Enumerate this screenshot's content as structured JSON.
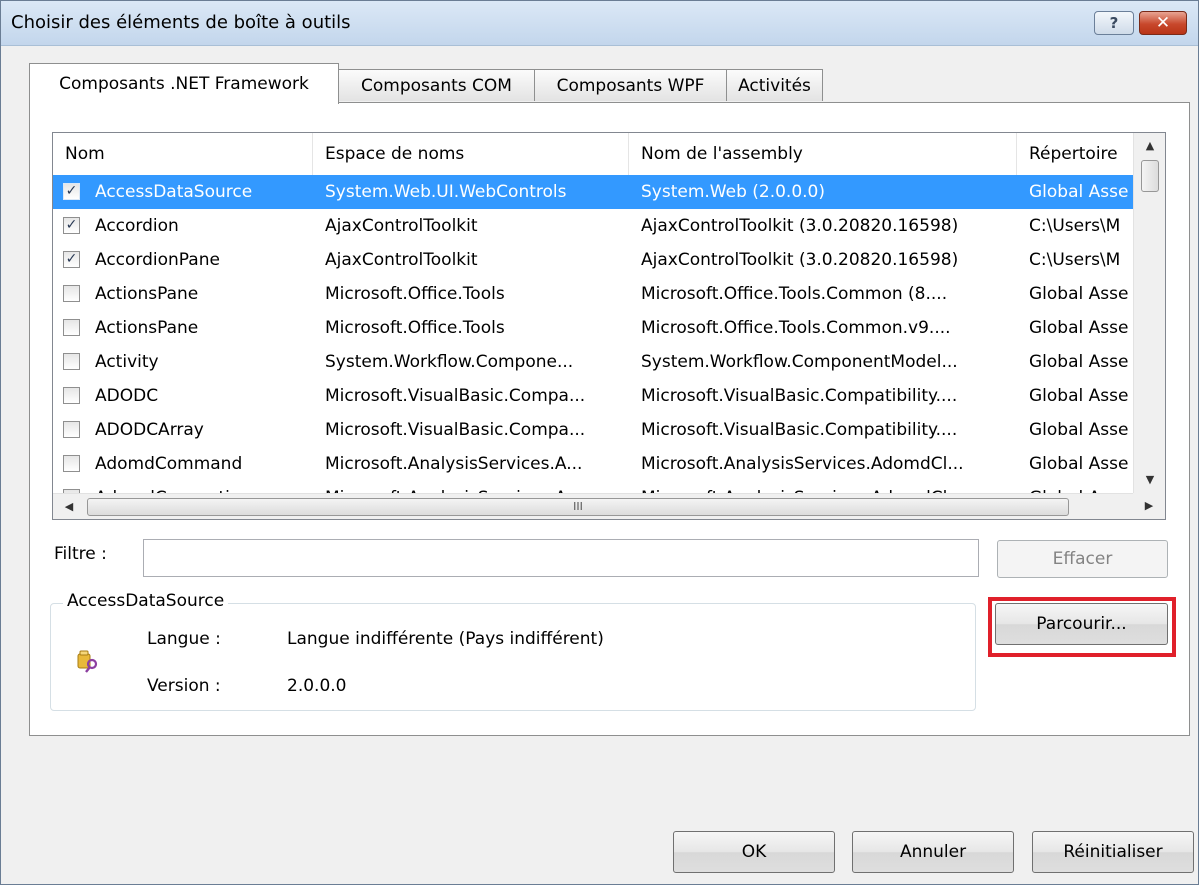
{
  "window": {
    "title": "Choisir des éléments de boîte à outils",
    "help_label": "?",
    "close_label": "✕"
  },
  "tabs": [
    {
      "label": "Composants .NET Framework"
    },
    {
      "label": "Composants COM"
    },
    {
      "label": "Composants WPF"
    },
    {
      "label": "Activités"
    }
  ],
  "list": {
    "columns": [
      "Nom",
      "Espace de noms",
      "Nom de l'assembly",
      "Répertoire"
    ],
    "rows": [
      {
        "checked": true,
        "selected": true,
        "name": "AccessDataSource",
        "namespace": "System.Web.UI.WebControls",
        "assembly": "System.Web (2.0.0.0)",
        "directory": "Global Asse"
      },
      {
        "checked": true,
        "selected": false,
        "name": "Accordion",
        "namespace": "AjaxControlToolkit",
        "assembly": "AjaxControlToolkit (3.0.20820.16598)",
        "directory": "C:\\Users\\M"
      },
      {
        "checked": true,
        "selected": false,
        "name": "AccordionPane",
        "namespace": "AjaxControlToolkit",
        "assembly": "AjaxControlToolkit (3.0.20820.16598)",
        "directory": "C:\\Users\\M"
      },
      {
        "checked": false,
        "selected": false,
        "name": "ActionsPane",
        "namespace": "Microsoft.Office.Tools",
        "assembly": "Microsoft.Office.Tools.Common (8....",
        "directory": "Global Asse"
      },
      {
        "checked": false,
        "selected": false,
        "name": "ActionsPane",
        "namespace": "Microsoft.Office.Tools",
        "assembly": "Microsoft.Office.Tools.Common.v9....",
        "directory": "Global Asse"
      },
      {
        "checked": false,
        "selected": false,
        "name": "Activity",
        "namespace": "System.Workflow.Compone...",
        "assembly": "System.Workflow.ComponentModel...",
        "directory": "Global Asse"
      },
      {
        "checked": false,
        "selected": false,
        "name": "ADODC",
        "namespace": "Microsoft.VisualBasic.Compa...",
        "assembly": "Microsoft.VisualBasic.Compatibility....",
        "directory": "Global Asse"
      },
      {
        "checked": false,
        "selected": false,
        "name": "ADODCArray",
        "namespace": "Microsoft.VisualBasic.Compa...",
        "assembly": "Microsoft.VisualBasic.Compatibility....",
        "directory": "Global Asse"
      },
      {
        "checked": false,
        "selected": false,
        "name": "AdomdCommand",
        "namespace": "Microsoft.AnalysisServices.A...",
        "assembly": "Microsoft.AnalysisServices.AdomdCl...",
        "directory": "Global Asse"
      },
      {
        "checked": false,
        "selected": false,
        "name": "AdomdConnection",
        "namespace": "Microsoft.AnalysisServices.A...",
        "assembly": "Microsoft.AnalysisServices.AdomdCl...",
        "directory": "Global Asse"
      }
    ],
    "hscroll_grip": "III"
  },
  "filter": {
    "label": "Filtre :",
    "value": "",
    "clear_label": "Effacer"
  },
  "details": {
    "group_title": "AccessDataSource",
    "icon": "assembly-icon",
    "language_label": "Langue :",
    "language_value": "Langue indifférente (Pays indifférent)",
    "version_label": "Version :",
    "version_value": "2.0.0.0"
  },
  "browse_label": "Parcourir...",
  "footer": {
    "ok_label": "OK",
    "cancel_label": "Annuler",
    "reset_label": "Réinitialiser"
  },
  "colors": {
    "selection": "#3399ff",
    "highlight_box": "#e0202a"
  }
}
